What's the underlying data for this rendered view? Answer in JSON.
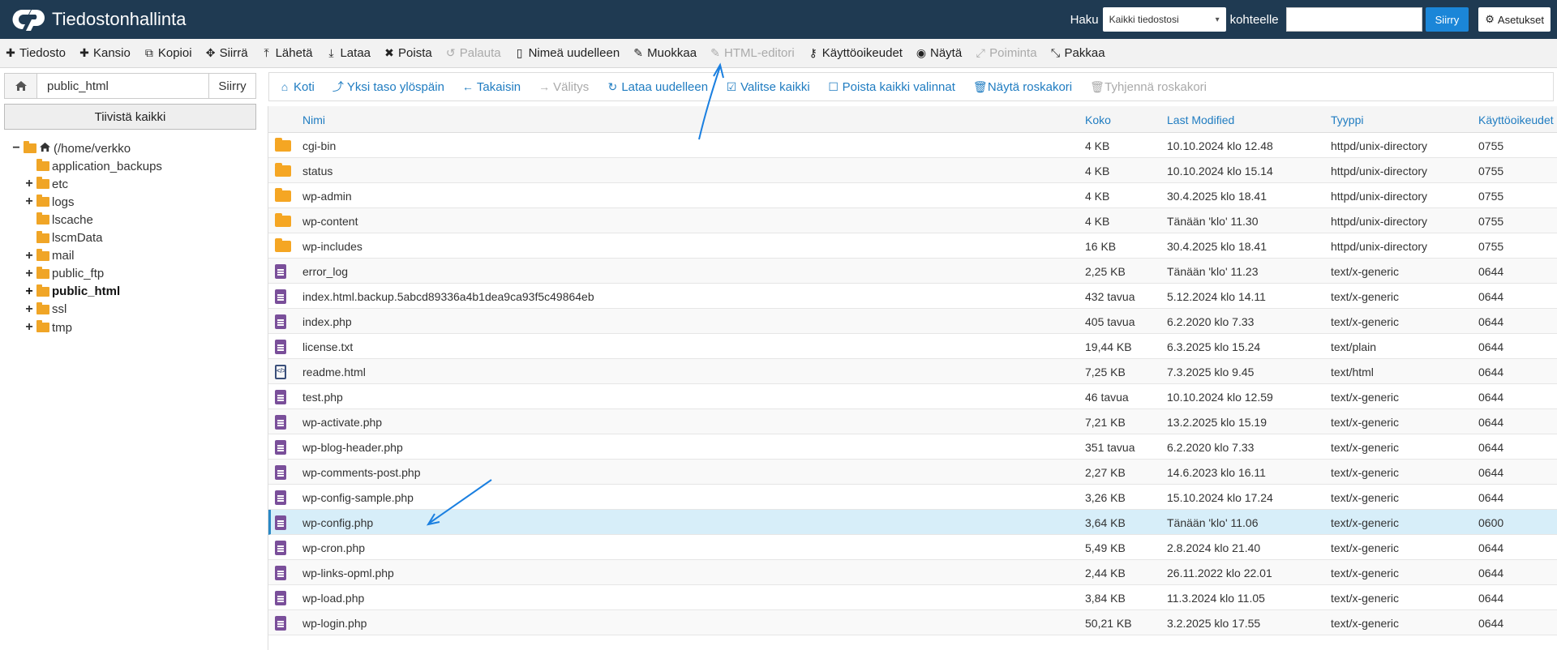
{
  "app": {
    "title": "Tiedostonhallinta",
    "logo_icon": "cpanel-logo-icon"
  },
  "search": {
    "label": "Haku",
    "scope_selected": "Kaikki tiedostosi",
    "for_label": "kohteelle",
    "input_value": "",
    "go_label": "Siirry"
  },
  "settings_label": "Asetukset",
  "toolbar": [
    {
      "label": "Tiedosto",
      "icon": "plus-icon",
      "glyph": "✚",
      "enabled": true
    },
    {
      "label": "Kansio",
      "icon": "plus-icon",
      "glyph": "✚",
      "enabled": true
    },
    {
      "label": "Kopioi",
      "icon": "copy-icon",
      "glyph": "⧉",
      "enabled": true
    },
    {
      "label": "Siirrä",
      "icon": "move-icon",
      "glyph": "✥",
      "enabled": true
    },
    {
      "label": "Lähetä",
      "icon": "upload-icon",
      "glyph": "⤒",
      "enabled": true
    },
    {
      "label": "Lataa",
      "icon": "download-icon",
      "glyph": "⤓",
      "enabled": true
    },
    {
      "label": "Poista",
      "icon": "delete-icon",
      "glyph": "✖",
      "enabled": true
    },
    {
      "label": "Palauta",
      "icon": "restore-icon",
      "glyph": "↺",
      "enabled": false
    },
    {
      "label": "Nimeä uudelleen",
      "icon": "rename-icon",
      "glyph": "▯",
      "enabled": true
    },
    {
      "label": "Muokkaa",
      "icon": "pencil-icon",
      "glyph": "✎",
      "enabled": true
    },
    {
      "label": "HTML-editori",
      "icon": "html-editor-icon",
      "glyph": "✎",
      "enabled": false
    },
    {
      "label": "Käyttöoikeudet",
      "icon": "key-icon",
      "glyph": "⚷",
      "enabled": true
    },
    {
      "label": "Näytä",
      "icon": "eye-icon",
      "glyph": "◉",
      "enabled": true
    },
    {
      "label": "Poiminta",
      "icon": "extract-icon",
      "glyph": "⤢",
      "enabled": false
    },
    {
      "label": "Pakkaa",
      "icon": "compress-icon",
      "glyph": "⤡",
      "enabled": true
    }
  ],
  "left": {
    "path_value": "public_html",
    "path_go": "Siirry",
    "collapse_all": "Tiivistä kaikki",
    "tree": [
      {
        "label": "(/home/verkko",
        "level": 0,
        "toggle": "−",
        "kind": "home",
        "bold": false
      },
      {
        "label": "application_backups",
        "level": 1,
        "toggle": "",
        "kind": "folder",
        "bold": false
      },
      {
        "label": "etc",
        "level": 1,
        "toggle": "+",
        "kind": "folder",
        "bold": false
      },
      {
        "label": "logs",
        "level": 1,
        "toggle": "+",
        "kind": "folder",
        "bold": false
      },
      {
        "label": "lscache",
        "level": 1,
        "toggle": "",
        "kind": "folder",
        "bold": false
      },
      {
        "label": "lscmData",
        "level": 1,
        "toggle": "",
        "kind": "folder",
        "bold": false
      },
      {
        "label": "mail",
        "level": 1,
        "toggle": "+",
        "kind": "folder",
        "bold": false
      },
      {
        "label": "public_ftp",
        "level": 1,
        "toggle": "+",
        "kind": "folder",
        "bold": false
      },
      {
        "label": "public_html",
        "level": 1,
        "toggle": "+",
        "kind": "folder",
        "bold": true
      },
      {
        "label": "ssl",
        "level": 1,
        "toggle": "+",
        "kind": "folder",
        "bold": false
      },
      {
        "label": "tmp",
        "level": 1,
        "toggle": "+",
        "kind": "folder",
        "bold": false
      }
    ]
  },
  "nav": [
    {
      "label": "Koti",
      "icon": "home-icon",
      "glyph": "⌂",
      "enabled": true
    },
    {
      "label": "Yksi taso ylöspäin",
      "icon": "level-up-icon",
      "glyph": "⤴",
      "enabled": true
    },
    {
      "label": "Takaisin",
      "icon": "arrow-left-icon",
      "glyph": "←",
      "enabled": true
    },
    {
      "label": "Välitys",
      "icon": "arrow-right-icon",
      "glyph": "→",
      "enabled": false
    },
    {
      "label": "Lataa uudelleen",
      "icon": "refresh-icon",
      "glyph": "↻",
      "enabled": true
    },
    {
      "label": "Valitse kaikki",
      "icon": "check-square-icon",
      "glyph": "☑",
      "enabled": true
    },
    {
      "label": "Poista kaikki valinnat",
      "icon": "square-icon",
      "glyph": "☐",
      "enabled": true
    },
    {
      "label": "Näytä roskakori",
      "icon": "trash-icon",
      "glyph": "🗑",
      "enabled": true
    },
    {
      "label": "Tyhjennä roskakori",
      "icon": "trash-icon",
      "glyph": "🗑",
      "enabled": false
    }
  ],
  "table": {
    "columns": [
      "Nimi",
      "Koko",
      "Last Modified",
      "Tyyppi",
      "Käyttöoikeudet"
    ],
    "rows": [
      {
        "name": "cgi-bin",
        "size": "4 KB",
        "modified": "10.10.2024 klo 12.48",
        "type": "httpd/unix-directory",
        "perms": "0755",
        "kind": "folder"
      },
      {
        "name": "status",
        "size": "4 KB",
        "modified": "10.10.2024 klo 15.14",
        "type": "httpd/unix-directory",
        "perms": "0755",
        "kind": "folder"
      },
      {
        "name": "wp-admin",
        "size": "4 KB",
        "modified": "30.4.2025 klo 18.41",
        "type": "httpd/unix-directory",
        "perms": "0755",
        "kind": "folder"
      },
      {
        "name": "wp-content",
        "size": "4 KB",
        "modified": "Tänään 'klo' 11.30",
        "type": "httpd/unix-directory",
        "perms": "0755",
        "kind": "folder"
      },
      {
        "name": "wp-includes",
        "size": "16 KB",
        "modified": "30.4.2025 klo 18.41",
        "type": "httpd/unix-directory",
        "perms": "0755",
        "kind": "folder"
      },
      {
        "name": "error_log",
        "size": "2,25 KB",
        "modified": "Tänään 'klo' 11.23",
        "type": "text/x-generic",
        "perms": "0644",
        "kind": "file"
      },
      {
        "name": "index.html.backup.5abcd89336a4b1dea9ca93f5c49864eb",
        "size": "432 tavua",
        "modified": "5.12.2024 klo 14.11",
        "type": "text/x-generic",
        "perms": "0644",
        "kind": "file"
      },
      {
        "name": "index.php",
        "size": "405 tavua",
        "modified": "6.2.2020 klo 7.33",
        "type": "text/x-generic",
        "perms": "0644",
        "kind": "file"
      },
      {
        "name": "license.txt",
        "size": "19,44 KB",
        "modified": "6.3.2025 klo 15.24",
        "type": "text/plain",
        "perms": "0644",
        "kind": "file"
      },
      {
        "name": "readme.html",
        "size": "7,25 KB",
        "modified": "7.3.2025 klo 9.45",
        "type": "text/html",
        "perms": "0644",
        "kind": "html"
      },
      {
        "name": "test.php",
        "size": "46 tavua",
        "modified": "10.10.2024 klo 12.59",
        "type": "text/x-generic",
        "perms": "0644",
        "kind": "file"
      },
      {
        "name": "wp-activate.php",
        "size": "7,21 KB",
        "modified": "13.2.2025 klo 15.19",
        "type": "text/x-generic",
        "perms": "0644",
        "kind": "file"
      },
      {
        "name": "wp-blog-header.php",
        "size": "351 tavua",
        "modified": "6.2.2020 klo 7.33",
        "type": "text/x-generic",
        "perms": "0644",
        "kind": "file"
      },
      {
        "name": "wp-comments-post.php",
        "size": "2,27 KB",
        "modified": "14.6.2023 klo 16.11",
        "type": "text/x-generic",
        "perms": "0644",
        "kind": "file"
      },
      {
        "name": "wp-config-sample.php",
        "size": "3,26 KB",
        "modified": "15.10.2024 klo 17.24",
        "type": "text/x-generic",
        "perms": "0644",
        "kind": "file"
      },
      {
        "name": "wp-config.php",
        "size": "3,64 KB",
        "modified": "Tänään 'klo' 11.06",
        "type": "text/x-generic",
        "perms": "0600",
        "kind": "file",
        "selected": true
      },
      {
        "name": "wp-cron.php",
        "size": "5,49 KB",
        "modified": "2.8.2024 klo 21.40",
        "type": "text/x-generic",
        "perms": "0644",
        "kind": "file"
      },
      {
        "name": "wp-links-opml.php",
        "size": "2,44 KB",
        "modified": "26.11.2022 klo 22.01",
        "type": "text/x-generic",
        "perms": "0644",
        "kind": "file"
      },
      {
        "name": "wp-load.php",
        "size": "3,84 KB",
        "modified": "11.3.2024 klo 11.05",
        "type": "text/x-generic",
        "perms": "0644",
        "kind": "file"
      },
      {
        "name": "wp-login.php",
        "size": "50,21 KB",
        "modified": "3.2.2025 klo 17.55",
        "type": "text/x-generic",
        "perms": "0644",
        "kind": "file"
      }
    ]
  },
  "colors": {
    "topbar": "#1f3a52",
    "accent": "#1b86d8",
    "link": "#1f7cc1",
    "folder": "#f5a623",
    "file": "#7a4f9a",
    "selected_row": "#d7eef9",
    "annotation_arrow": "#1a7fe0"
  }
}
